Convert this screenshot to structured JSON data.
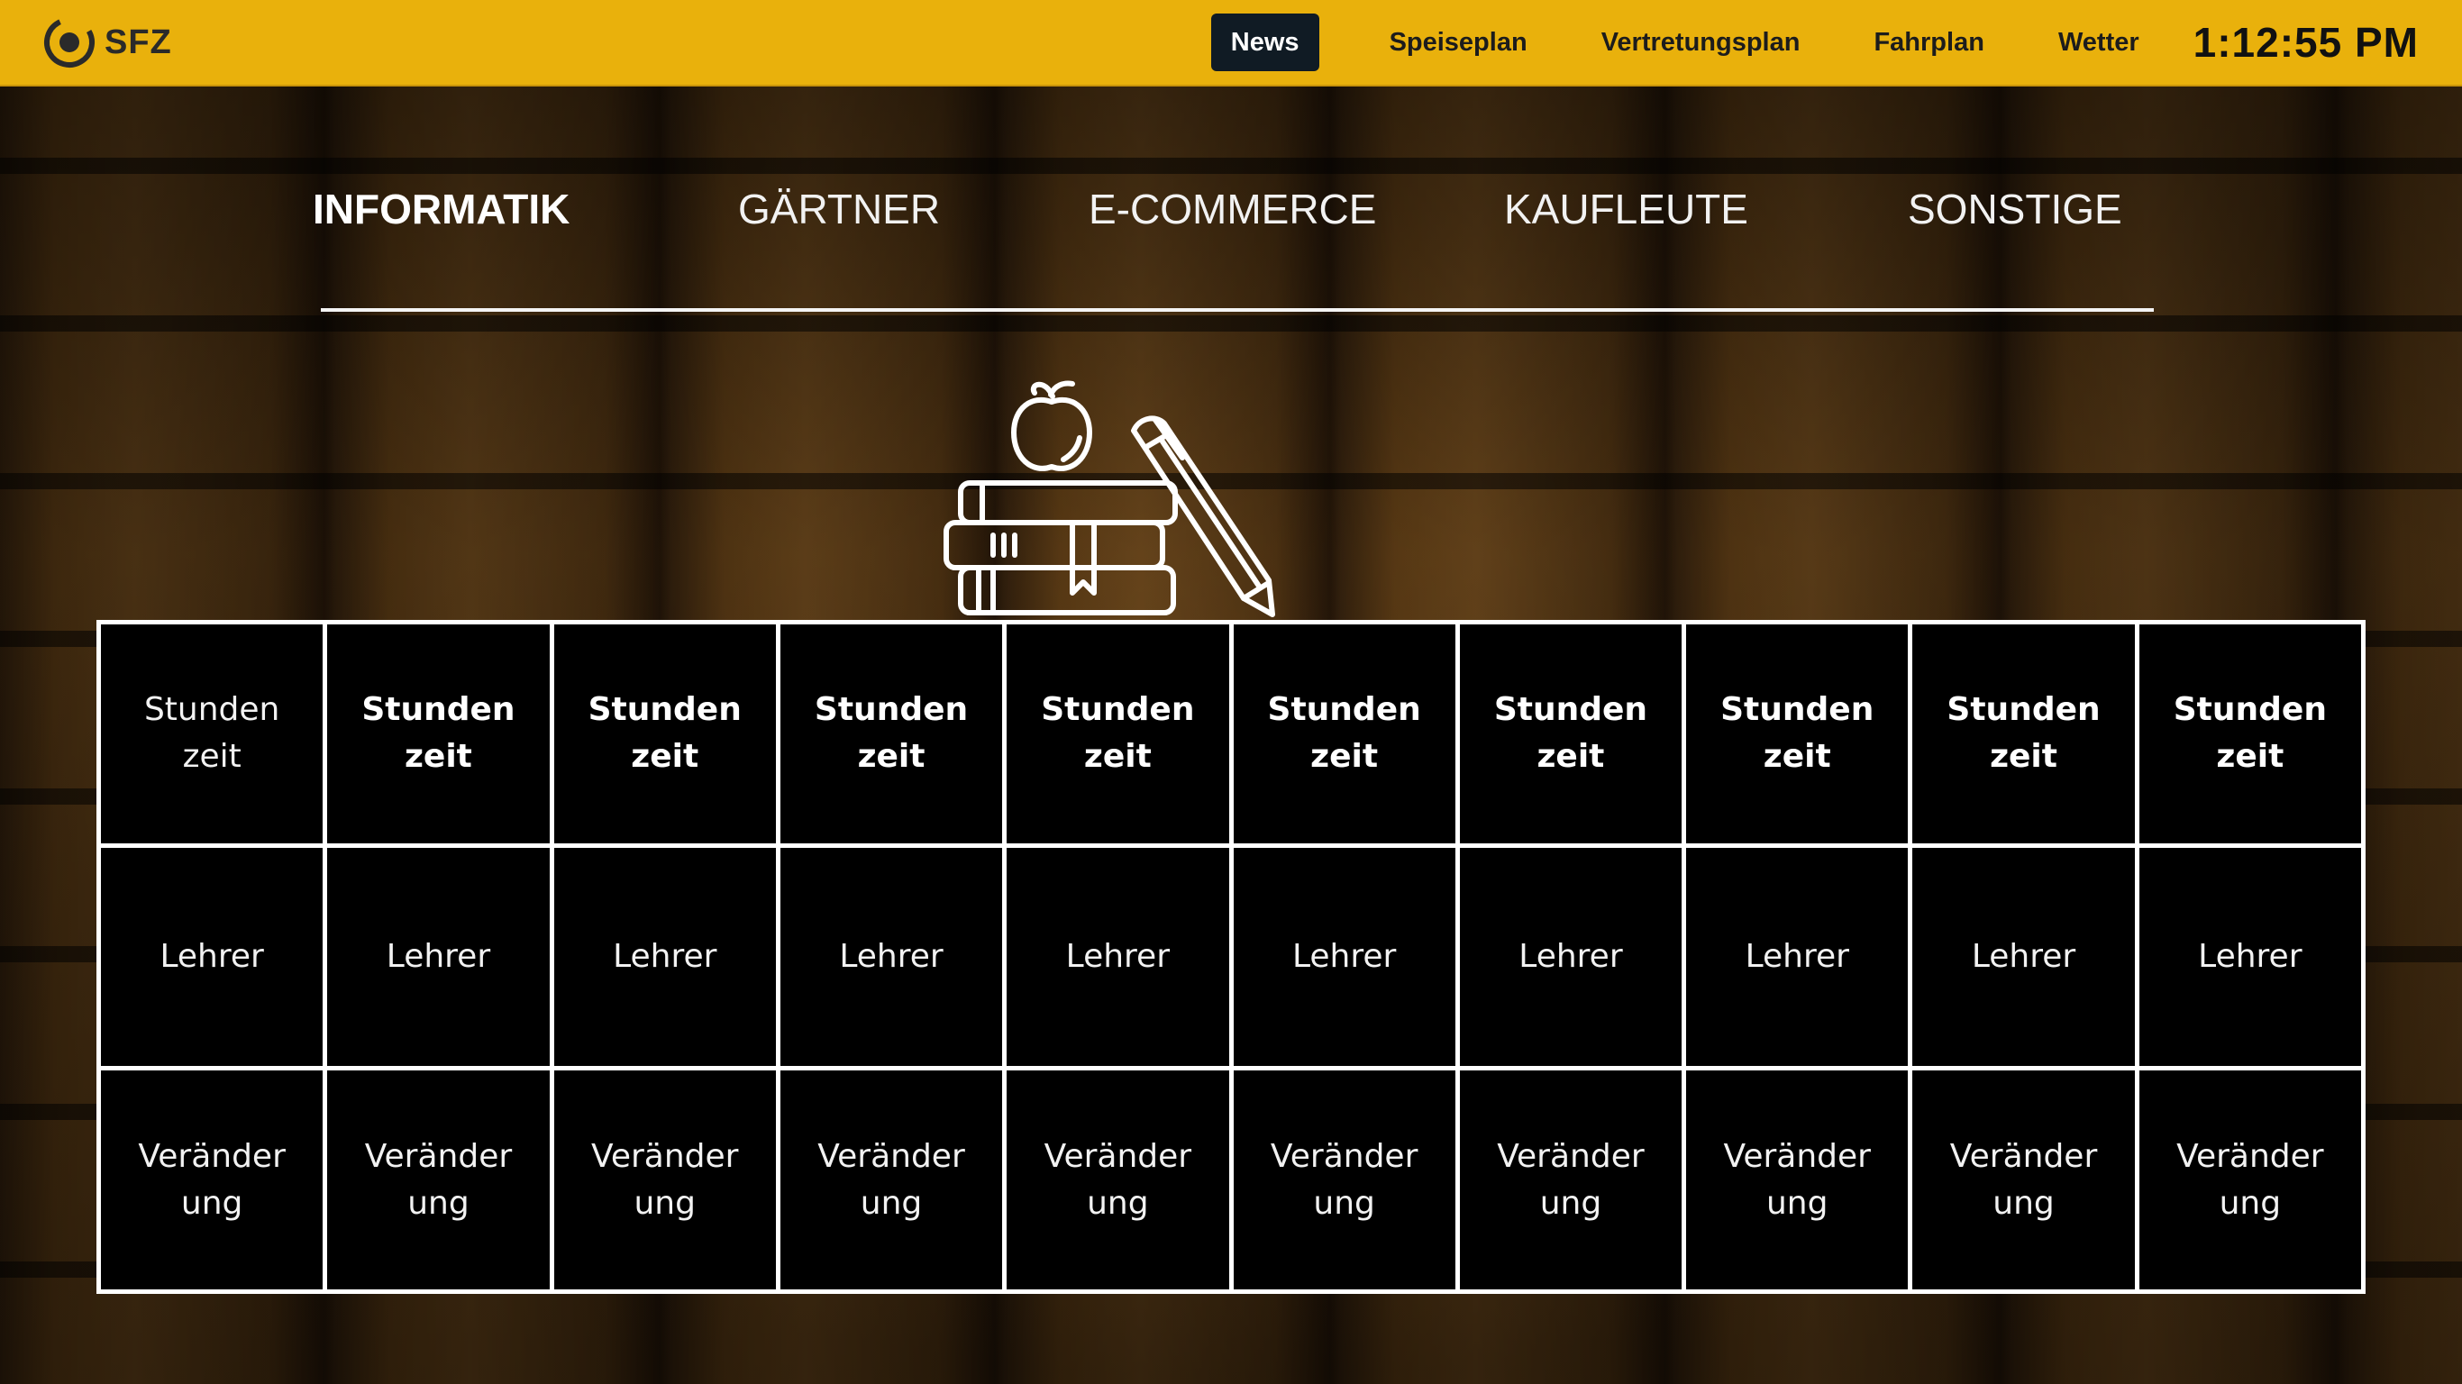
{
  "header": {
    "logo_text": "SFZ",
    "nav": [
      "News",
      "Speiseplan",
      "Vertretungsplan",
      "Fahrplan",
      "Wetter"
    ],
    "active_nav": "News",
    "clock": "1:12:55 PM",
    "colors": {
      "bar": "#e9b10c",
      "active_nav_bg": "#101b24"
    }
  },
  "tabs": [
    "INFORMATIK",
    "GÄRTNER",
    "E-COMMERCE",
    "KAUFLEUTE",
    "SONSTIGE"
  ],
  "active_tab": "INFORMATIK",
  "icon": "books-apple-pencil-icon",
  "schedule": {
    "rows": [
      {
        "name": "stundenzeit",
        "cells": [
          {
            "line1": "Stunden",
            "line2": "zeit"
          },
          {
            "line1": "Stunden",
            "line2": "zeit"
          },
          {
            "line1": "Stunden",
            "line2": "zeit"
          },
          {
            "line1": "Stunden",
            "line2": "zeit"
          },
          {
            "line1": "Stunden",
            "line2": "zeit"
          },
          {
            "line1": "Stunden",
            "line2": "zeit"
          },
          {
            "line1": "Stunden",
            "line2": "zeit"
          },
          {
            "line1": "Stunden",
            "line2": "zeit"
          },
          {
            "line1": "Stunden",
            "line2": "zeit"
          },
          {
            "line1": "Stunden",
            "line2": "zeit"
          }
        ]
      },
      {
        "name": "lehrer",
        "cells": [
          {
            "line1": "Lehrer"
          },
          {
            "line1": "Lehrer"
          },
          {
            "line1": "Lehrer"
          },
          {
            "line1": "Lehrer"
          },
          {
            "line1": "Lehrer"
          },
          {
            "line1": "Lehrer"
          },
          {
            "line1": "Lehrer"
          },
          {
            "line1": "Lehrer"
          },
          {
            "line1": "Lehrer"
          },
          {
            "line1": "Lehrer"
          }
        ]
      },
      {
        "name": "veraenderung",
        "cells": [
          {
            "line1": "Veränder",
            "line2": "ung"
          },
          {
            "line1": "Veränder",
            "line2": "ung"
          },
          {
            "line1": "Veränder",
            "line2": "ung"
          },
          {
            "line1": "Veränder",
            "line2": "ung"
          },
          {
            "line1": "Veränder",
            "line2": "ung"
          },
          {
            "line1": "Veränder",
            "line2": "ung"
          },
          {
            "line1": "Veränder",
            "line2": "ung"
          },
          {
            "line1": "Veränder",
            "line2": "ung"
          },
          {
            "line1": "Veränder",
            "line2": "ung"
          },
          {
            "line1": "Veränder",
            "line2": "ung"
          }
        ]
      }
    ]
  }
}
